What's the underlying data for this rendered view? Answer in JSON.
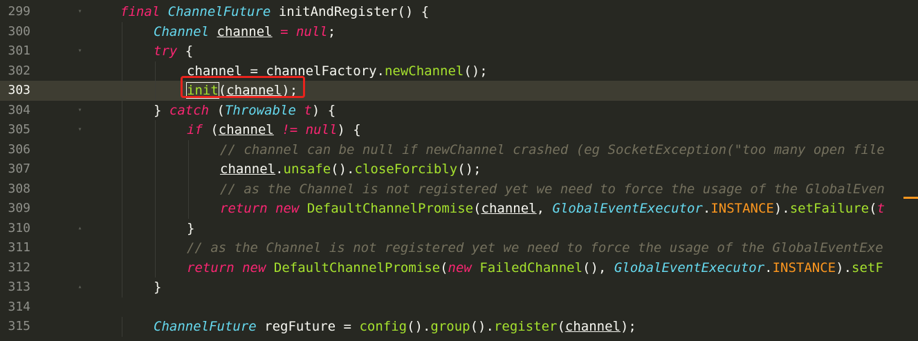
{
  "editor": {
    "lines": [
      {
        "num": "299",
        "indent": 0,
        "fold": "▾",
        "tokens": [
          [
            "k",
            "final"
          ],
          [
            "p",
            " "
          ],
          [
            "t",
            "ChannelFuture"
          ],
          [
            "p",
            " initAndRegister() {"
          ]
        ]
      },
      {
        "num": "300",
        "indent": 1,
        "fold": "",
        "tokens": [
          [
            "t",
            "Channel"
          ],
          [
            "p",
            " "
          ],
          [
            "v",
            "channel"
          ],
          [
            "p",
            " "
          ],
          [
            "k",
            "="
          ],
          [
            "p",
            " "
          ],
          [
            "k",
            "null"
          ],
          [
            "p",
            ";"
          ]
        ]
      },
      {
        "num": "301",
        "indent": 1,
        "fold": "▾",
        "tokens": [
          [
            "k",
            "try"
          ],
          [
            "p",
            " {"
          ]
        ]
      },
      {
        "num": "302",
        "indent": 2,
        "fold": "",
        "tokens": [
          [
            "p",
            "channel = channelFactory."
          ],
          [
            "f",
            "newChannel"
          ],
          [
            "p",
            "();"
          ]
        ]
      },
      {
        "num": "303",
        "indent": 2,
        "fold": "",
        "current": true,
        "tokens": [
          [
            "fb",
            "init"
          ],
          [
            "p",
            "("
          ],
          [
            "v",
            "channel"
          ],
          [
            "p",
            ");"
          ]
        ]
      },
      {
        "num": "304",
        "indent": 1,
        "fold": "▾",
        "tokens": [
          [
            "p",
            "} "
          ],
          [
            "k",
            "catch"
          ],
          [
            "p",
            " ("
          ],
          [
            "t",
            "Throwable"
          ],
          [
            "p",
            " "
          ],
          [
            "k",
            "t"
          ],
          [
            "p",
            ") {"
          ]
        ]
      },
      {
        "num": "305",
        "indent": 2,
        "fold": "▾",
        "tokens": [
          [
            "k",
            "if"
          ],
          [
            "p",
            " ("
          ],
          [
            "v",
            "channel"
          ],
          [
            "p",
            " "
          ],
          [
            "k",
            "!="
          ],
          [
            "p",
            " "
          ],
          [
            "k",
            "null"
          ],
          [
            "p",
            ") {"
          ]
        ]
      },
      {
        "num": "306",
        "indent": 3,
        "fold": "",
        "tokens": [
          [
            "c",
            "// channel can be null if newChannel crashed (eg SocketException(\"too many open file"
          ]
        ]
      },
      {
        "num": "307",
        "indent": 3,
        "fold": "",
        "tokens": [
          [
            "v",
            "channel"
          ],
          [
            "p",
            "."
          ],
          [
            "f",
            "unsafe"
          ],
          [
            "p",
            "()."
          ],
          [
            "f",
            "closeForcibly"
          ],
          [
            "p",
            "();"
          ]
        ]
      },
      {
        "num": "308",
        "indent": 3,
        "fold": "",
        "tokens": [
          [
            "c",
            "// as the Channel is not registered yet we need to force the usage of the GlobalEven"
          ]
        ]
      },
      {
        "num": "309",
        "indent": 3,
        "fold": "",
        "tokens": [
          [
            "k",
            "return"
          ],
          [
            "p",
            " "
          ],
          [
            "k",
            "new"
          ],
          [
            "p",
            " "
          ],
          [
            "f",
            "DefaultChannelPromise"
          ],
          [
            "p",
            "("
          ],
          [
            "v",
            "channel"
          ],
          [
            "p",
            ", "
          ],
          [
            "t",
            "GlobalEventExecutor"
          ],
          [
            "p",
            "."
          ],
          [
            "cst",
            "INSTANCE"
          ],
          [
            "p",
            ")."
          ],
          [
            "f",
            "setFailure"
          ],
          [
            "p",
            "("
          ],
          [
            "k",
            "t"
          ]
        ]
      },
      {
        "num": "310",
        "indent": 2,
        "fold": "▴",
        "tokens": [
          [
            "p",
            "}"
          ]
        ]
      },
      {
        "num": "311",
        "indent": 2,
        "fold": "",
        "tokens": [
          [
            "c",
            "// as the Channel is not registered yet we need to force the usage of the GlobalEventExe"
          ]
        ]
      },
      {
        "num": "312",
        "indent": 2,
        "fold": "",
        "tokens": [
          [
            "k",
            "return"
          ],
          [
            "p",
            " "
          ],
          [
            "k",
            "new"
          ],
          [
            "p",
            " "
          ],
          [
            "f",
            "DefaultChannelPromise"
          ],
          [
            "p",
            "("
          ],
          [
            "k",
            "new"
          ],
          [
            "p",
            " "
          ],
          [
            "f",
            "FailedChannel"
          ],
          [
            "p",
            "(), "
          ],
          [
            "t",
            "GlobalEventExecutor"
          ],
          [
            "p",
            "."
          ],
          [
            "cst",
            "INSTANCE"
          ],
          [
            "p",
            ")."
          ],
          [
            "f",
            "setF"
          ]
        ]
      },
      {
        "num": "313",
        "indent": 1,
        "fold": "▴",
        "tokens": [
          [
            "p",
            "}"
          ]
        ]
      },
      {
        "num": "314",
        "indent": 0,
        "fold": "",
        "tokens": []
      },
      {
        "num": "315",
        "indent": 1,
        "fold": "",
        "tokens": [
          [
            "t",
            "ChannelFuture"
          ],
          [
            "p",
            " regFuture = "
          ],
          [
            "f",
            "config"
          ],
          [
            "p",
            "()."
          ],
          [
            "f",
            "group"
          ],
          [
            "p",
            "()."
          ],
          [
            "f",
            "register"
          ],
          [
            "p",
            "("
          ],
          [
            "v",
            "channel"
          ],
          [
            "p",
            ");"
          ]
        ]
      }
    ]
  },
  "colors": {
    "background": "#272822",
    "current_line": "#3e3d32",
    "keyword": "#f92672",
    "type": "#66d9ef",
    "function": "#a6e22e",
    "comment": "#75715e",
    "constant": "#fd971f",
    "highlight_box": "#e8231d"
  }
}
